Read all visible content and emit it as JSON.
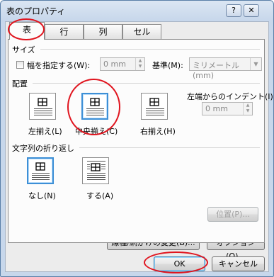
{
  "window": {
    "title": "表のプロパティ",
    "help_label": "?",
    "close_label": "✕"
  },
  "tabs": [
    {
      "label": "表"
    },
    {
      "label": "行"
    },
    {
      "label": "列"
    },
    {
      "label": "セル"
    }
  ],
  "size": {
    "group_label": "サイズ",
    "width_checkbox_label": "幅を指定する(W):",
    "width_value": "0 mm",
    "basis_label": "基準(M):",
    "basis_value": "ミリメートル (mm)"
  },
  "alignment": {
    "group_label": "配置",
    "options": [
      {
        "label": "左揃え(L)"
      },
      {
        "label": "中央揃え(C)"
      },
      {
        "label": "右揃え(H)"
      }
    ],
    "indent_label": "左端からのインデント(I):",
    "indent_value": "0 mm"
  },
  "wrapping": {
    "group_label": "文字列の折り返し",
    "options": [
      {
        "label": "なし(N)"
      },
      {
        "label": "する(A)"
      }
    ],
    "position_button": "位置(P)..."
  },
  "buttons": {
    "borders": "線種/網かけの変更(B)...",
    "options": "オプション(O)...",
    "ok": "OK",
    "cancel": "キャンセル"
  },
  "colors": {
    "highlight": "#e0141e",
    "selected_border": "#3d8fd6"
  }
}
